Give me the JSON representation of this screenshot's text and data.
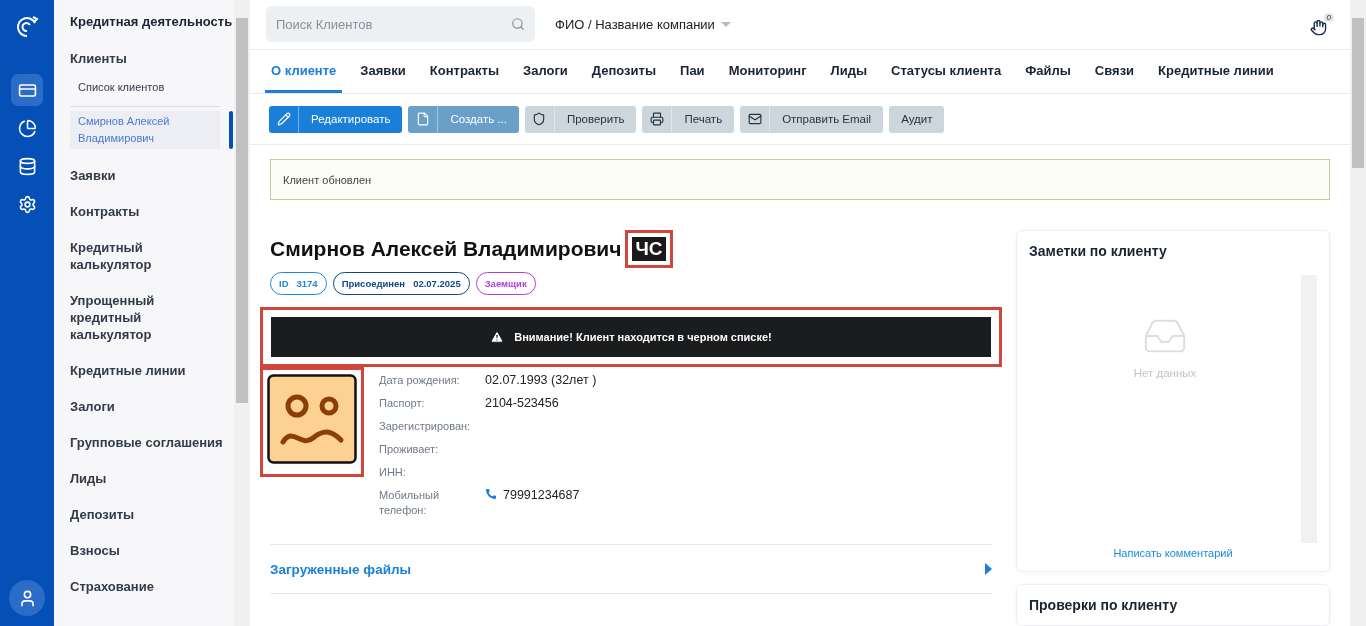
{
  "rail": {
    "items": [
      {
        "selected": true
      },
      {
        "selected": false
      },
      {
        "selected": false
      },
      {
        "selected": false
      }
    ]
  },
  "sidebar": {
    "title": "Кредитная деятельность",
    "items": [
      {
        "label": "Клиенты",
        "children": [
          {
            "label": "Список клиентов",
            "selected": false
          },
          {
            "label": "Смирнов Алексей Владимирович",
            "selected": true
          }
        ]
      },
      {
        "label": "Заявки"
      },
      {
        "label": "Контракты"
      },
      {
        "label": "Кредитный калькулятор"
      },
      {
        "label": "Упрощенный кредитный калькулятор"
      },
      {
        "label": "Кредитные линии"
      },
      {
        "label": "Залоги"
      },
      {
        "label": "Групповые соглашения"
      },
      {
        "label": "Лиды"
      },
      {
        "label": "Депозиты"
      },
      {
        "label": "Взносы"
      },
      {
        "label": "Страхование"
      }
    ]
  },
  "header": {
    "search": {
      "placeholder": "Поиск Клиентов"
    },
    "search_mode": "ФИО / Название компании",
    "notifications": "0"
  },
  "tabs": [
    {
      "label": "О клиенте",
      "selected": true
    },
    {
      "label": "Заявки",
      "selected": false
    },
    {
      "label": "Контракты",
      "selected": false
    },
    {
      "label": "Залоги",
      "selected": false
    },
    {
      "label": "Депозиты",
      "selected": false
    },
    {
      "label": "Паи",
      "selected": false
    },
    {
      "label": "Мониторинг",
      "selected": false
    },
    {
      "label": "Лиды",
      "selected": false
    },
    {
      "label": "Статусы клиента",
      "selected": false
    },
    {
      "label": "Файлы",
      "selected": false
    },
    {
      "label": "Связи",
      "selected": false
    },
    {
      "label": "Кредитные линии",
      "selected": false
    }
  ],
  "toolbar": [
    {
      "label": "Редактировать",
      "kind": "primary"
    },
    {
      "label": "Создать ...",
      "kind": "muted"
    },
    {
      "label": "Проверить",
      "kind": "plain"
    },
    {
      "label": "Печать",
      "kind": "plain"
    },
    {
      "label": "Отправить Email",
      "kind": "plain"
    },
    {
      "label": "Аудит",
      "kind": "plain"
    }
  ],
  "notice": "Клиент обновлен",
  "client": {
    "name": "Смирнов Алексей Владимирович",
    "blacklist_badge": "ЧС",
    "badges": [
      {
        "label": "ID",
        "value": "3174",
        "color": "#1e88e5"
      },
      {
        "label": "Присоединен",
        "value": "02.07.2025",
        "color": "#0d4a86"
      },
      {
        "label": "Заемщик",
        "color": "#b03fd6"
      }
    ],
    "warning": "Внимание! Клиент находится в черном списке!",
    "fields": [
      {
        "label": "Дата рождения:",
        "value": "02.07.1993 (32лет )"
      },
      {
        "label": "Паспорт:",
        "value": "2104-523456"
      },
      {
        "label": "Зарегистрирован:"
      },
      {
        "label": "Проживает:"
      },
      {
        "label": "ИНН:"
      },
      {
        "label": "Мобильный телефон:",
        "value": "79991234687",
        "kind": "phone"
      }
    ],
    "files_section": "Загруженные файлы"
  },
  "notes": {
    "title": "Заметки по клиенту",
    "empty": "Нет данных",
    "link": "Написать комментарий"
  },
  "checks": {
    "title": "Проверки по клиенту"
  }
}
